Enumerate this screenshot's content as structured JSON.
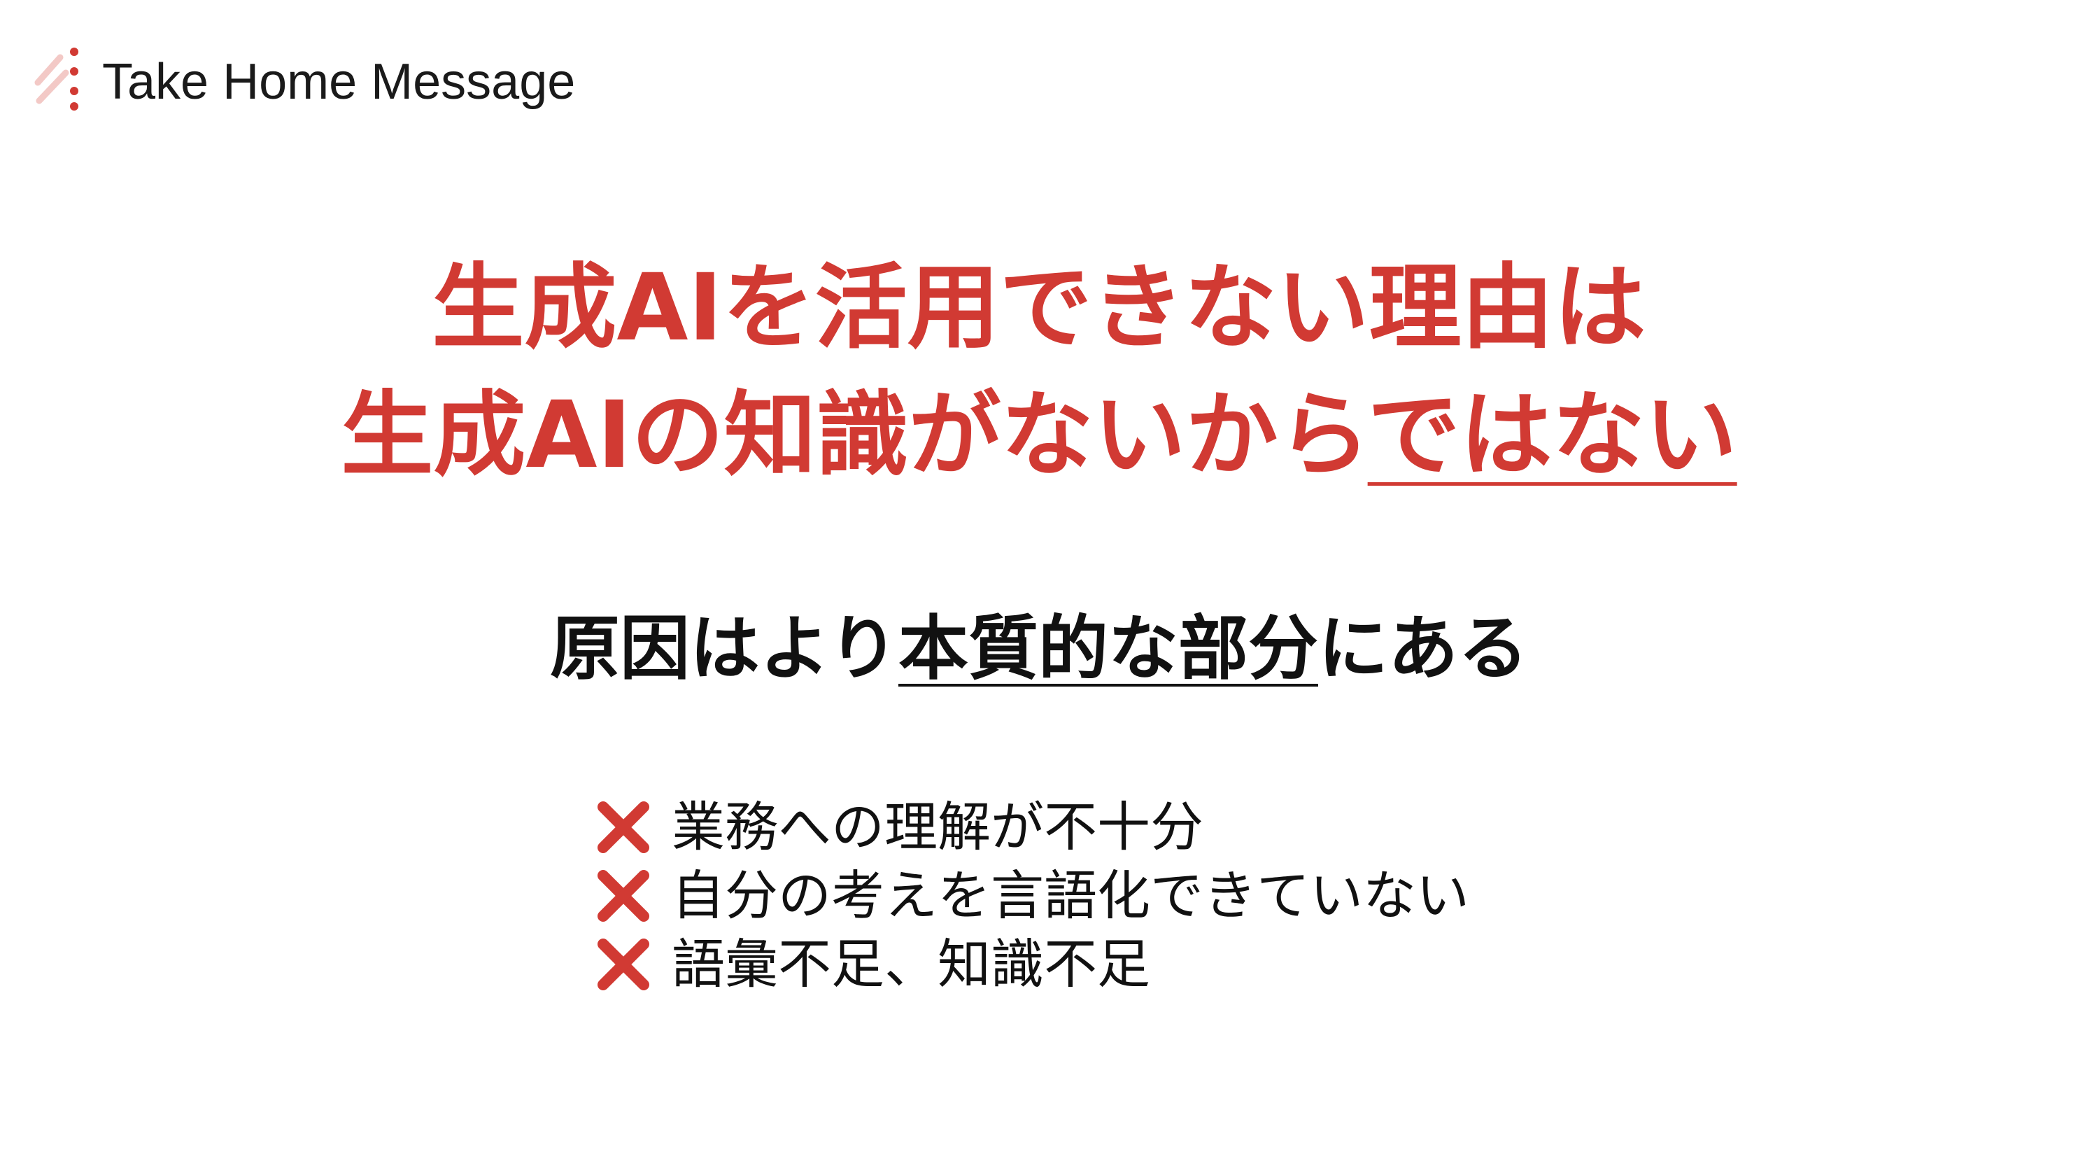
{
  "header": {
    "title": "Take Home Message",
    "logo_icon": "dotted-arrow-logo-icon"
  },
  "headline": {
    "line1": "生成AIを活用できない理由は",
    "line2_main": "生成AIの知識がないから",
    "line2_emphasis": "ではない"
  },
  "subheading": {
    "prefix": "原因はより",
    "emphasis": "本質的な部分",
    "suffix": "にある"
  },
  "reasons": [
    {
      "icon": "cross-mark-icon",
      "text": "業務への理解が不十分"
    },
    {
      "icon": "cross-mark-icon",
      "text": "自分の考えを言語化できていない"
    },
    {
      "icon": "cross-mark-icon",
      "text": "語彙不足、知識不足"
    }
  ],
  "colors": {
    "accent": "#d13a33",
    "text": "#111111",
    "background": "#ffffff"
  }
}
